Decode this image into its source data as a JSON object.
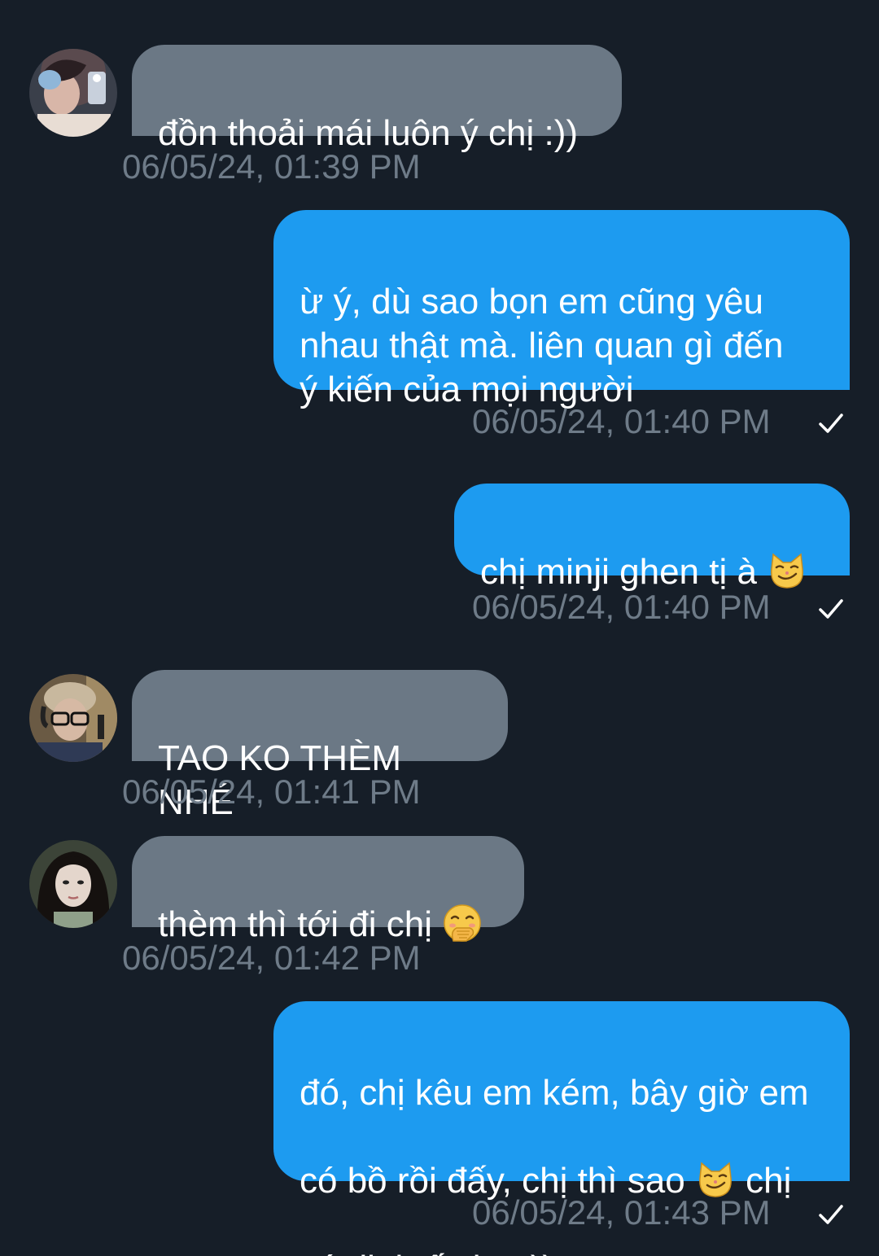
{
  "messages": [
    {
      "text": "đồn thoải mái luôn ý chị :))",
      "time": "06/05/24, 01:39 PM",
      "avatar": "avatar-girl-selfie"
    },
    {
      "text": "ừ ý, dù sao bọn em cũng yêu\nnhau thật mà. liên quan gì đến\ný kiến của mọi người",
      "time": "06/05/24, 01:40 PM"
    },
    {
      "text_before": "chị minji ghen tị à ",
      "emoji": "smirking-cat-emoji",
      "time": "06/05/24, 01:40 PM"
    },
    {
      "text": "TAO KO THÈM NHÉ",
      "time": "06/05/24, 01:41 PM",
      "avatar": "avatar-headphones-glasses"
    },
    {
      "text_before": "thèm thì tới đi chị ",
      "emoji": "hand-over-mouth-emoji",
      "time": "06/05/24, 01:42 PM",
      "avatar": "avatar-dark-hair"
    },
    {
      "line1": "đó, chị kêu em kém, bây giờ em",
      "line2_before": "có bồ rồi đấy, chị thì sao ",
      "emoji": "smirking-cat-emoji",
      "line2_after": " chị",
      "line3": "có định ấy ko :))",
      "time": "06/05/24, 01:43 PM"
    }
  ],
  "colors": {
    "background": "#161e28",
    "incoming_bubble": "#6b7885",
    "outgoing_bubble": "#1d9bf0",
    "timestamp": "#6e7b88",
    "text": "#ffffff"
  }
}
